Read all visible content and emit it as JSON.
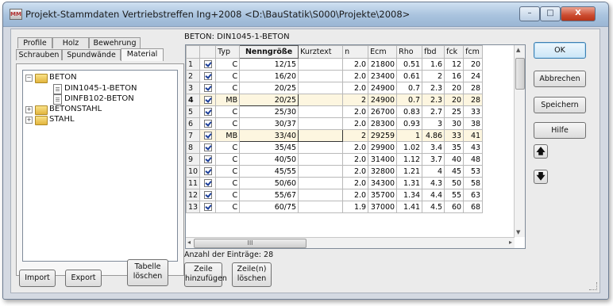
{
  "window": {
    "title": "Projekt-Stammdaten Vertriebstreffen Ing+2008 <D:\\BauStatik\\S000\\Projekte\\2008>",
    "minimize_label": "–",
    "maximize_label": "□",
    "close_label": "X"
  },
  "tabs": {
    "row1": [
      "Profile",
      "Holz",
      "Bewehrung"
    ],
    "row2": [
      "Schrauben",
      "Spundwände",
      "Material"
    ],
    "active": "Material"
  },
  "tree": {
    "beton": "BETON",
    "din1045": "DIN1045-1-BETON",
    "dinfb102": "DINFB102-BETON",
    "betonstahl": "BETONSTAHL",
    "stahl": "STAHL",
    "expand_minus": "−",
    "expand_plus": "+"
  },
  "grid": {
    "title": "BETON: DIN1045-1-BETON",
    "columns": [
      "",
      "",
      "Typ",
      "Nenngröße",
      "Kurztext",
      "n",
      "Ecm",
      "Rho",
      "fbd",
      "fck",
      "fcm"
    ],
    "rows": [
      {
        "nr": "1",
        "typ": "C",
        "nenn": "12/15",
        "kurz": "",
        "n": "2.0",
        "ecm": "21800",
        "rho": "0.51",
        "fbd": "1.6",
        "fck": "12",
        "fcm": "20"
      },
      {
        "nr": "2",
        "typ": "C",
        "nenn": "16/20",
        "kurz": "",
        "n": "2.0",
        "ecm": "23400",
        "rho": "0.61",
        "fbd": "2",
        "fck": "16",
        "fcm": "24"
      },
      {
        "nr": "3",
        "typ": "C",
        "nenn": "20/25",
        "kurz": "",
        "n": "2.0",
        "ecm": "24900",
        "rho": "0.7",
        "fbd": "2.3",
        "fck": "20",
        "fcm": "28"
      },
      {
        "nr": "4",
        "typ": "MB",
        "nenn": "20/25",
        "kurz": "",
        "n": "2",
        "ecm": "24900",
        "rho": "0.7",
        "fbd": "2.3",
        "fck": "20",
        "fcm": "28"
      },
      {
        "nr": "5",
        "typ": "C",
        "nenn": "25/30",
        "kurz": "",
        "n": "2.0",
        "ecm": "26700",
        "rho": "0.83",
        "fbd": "2.7",
        "fck": "25",
        "fcm": "33"
      },
      {
        "nr": "6",
        "typ": "C",
        "nenn": "30/37",
        "kurz": "",
        "n": "2.0",
        "ecm": "28300",
        "rho": "0.93",
        "fbd": "3",
        "fck": "30",
        "fcm": "38"
      },
      {
        "nr": "7",
        "typ": "MB",
        "nenn": "33/40",
        "kurz": "",
        "n": "2",
        "ecm": "29259",
        "rho": "1",
        "fbd": "4.86",
        "fck": "33",
        "fcm": "41"
      },
      {
        "nr": "8",
        "typ": "C",
        "nenn": "35/45",
        "kurz": "",
        "n": "2.0",
        "ecm": "29900",
        "rho": "1.02",
        "fbd": "3.4",
        "fck": "35",
        "fcm": "43"
      },
      {
        "nr": "9",
        "typ": "C",
        "nenn": "40/50",
        "kurz": "",
        "n": "2.0",
        "ecm": "31400",
        "rho": "1.12",
        "fbd": "3.7",
        "fck": "40",
        "fcm": "48"
      },
      {
        "nr": "10",
        "typ": "C",
        "nenn": "45/55",
        "kurz": "",
        "n": "2.0",
        "ecm": "32800",
        "rho": "1.21",
        "fbd": "4",
        "fck": "45",
        "fcm": "53"
      },
      {
        "nr": "11",
        "typ": "C",
        "nenn": "50/60",
        "kurz": "",
        "n": "2.0",
        "ecm": "34300",
        "rho": "1.31",
        "fbd": "4.3",
        "fck": "50",
        "fcm": "58"
      },
      {
        "nr": "12",
        "typ": "C",
        "nenn": "55/67",
        "kurz": "",
        "n": "2.0",
        "ecm": "35700",
        "rho": "1.34",
        "fbd": "4.4",
        "fck": "55",
        "fcm": "63"
      },
      {
        "nr": "13",
        "typ": "C",
        "nenn": "60/75",
        "kurz": "",
        "n": "1.9",
        "ecm": "37000",
        "rho": "1.41",
        "fbd": "4.5",
        "fck": "60",
        "fcm": "68"
      }
    ],
    "scroll_up": "▲",
    "scroll_down": "▼",
    "scroll_left": "◂",
    "scroll_right": "▸",
    "hscroll_grip": "III"
  },
  "count_label": "Anzahl der Einträge: 28",
  "buttons": {
    "import": "Import",
    "export": "Export",
    "tabelle_l1": "Tabelle",
    "tabelle_l2": "löschen",
    "zeile_add_l1": "Zeile",
    "zeile_add_l2": "hinzufügen",
    "zeile_del_l1": "Zeile(n)",
    "zeile_del_l2": "löschen",
    "ok": "OK",
    "abbrechen": "Abbrechen",
    "speichern": "Speichern",
    "hilfe": "Hilfe",
    "up_arrow": "🡅",
    "down_arrow": "🡇"
  }
}
